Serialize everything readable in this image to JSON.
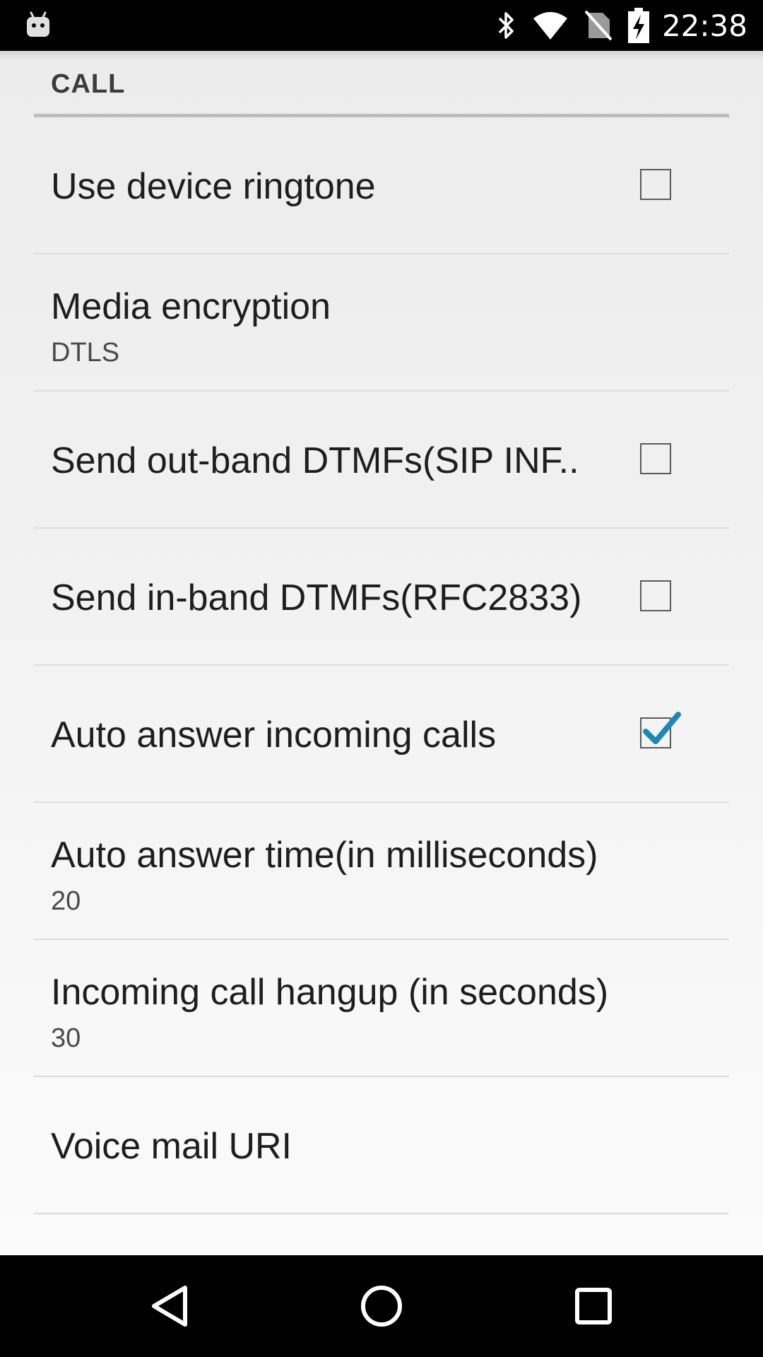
{
  "status_bar": {
    "time": "22:38",
    "icons": [
      "android-debug-icon",
      "bluetooth-icon",
      "wifi-icon",
      "no-sim-icon",
      "battery-charging-icon"
    ]
  },
  "section": {
    "title": "CALL"
  },
  "preferences": [
    {
      "title": "Use device ringtone",
      "type": "checkbox",
      "checked": false
    },
    {
      "title": "Media encryption",
      "summary": "DTLS",
      "type": "list"
    },
    {
      "title": "Send out-band DTMFs(SIP INF..",
      "type": "checkbox",
      "checked": false
    },
    {
      "title": "Send in-band DTMFs(RFC2833)",
      "type": "checkbox",
      "checked": false
    },
    {
      "title": "Auto answer incoming calls",
      "type": "checkbox",
      "checked": true
    },
    {
      "title": "Auto answer time(in milliseconds)",
      "summary": "20",
      "type": "edit"
    },
    {
      "title": "Incoming call hangup (in seconds)",
      "summary": "30",
      "type": "edit"
    },
    {
      "title": "Voice mail URI",
      "type": "edit"
    }
  ],
  "nav_bar": {
    "buttons": [
      "back-icon",
      "home-icon",
      "recents-icon"
    ]
  },
  "colors": {
    "check_accent": "#1e88b4",
    "status_bar_bg": "#000000",
    "nav_bar_bg": "#000000"
  }
}
